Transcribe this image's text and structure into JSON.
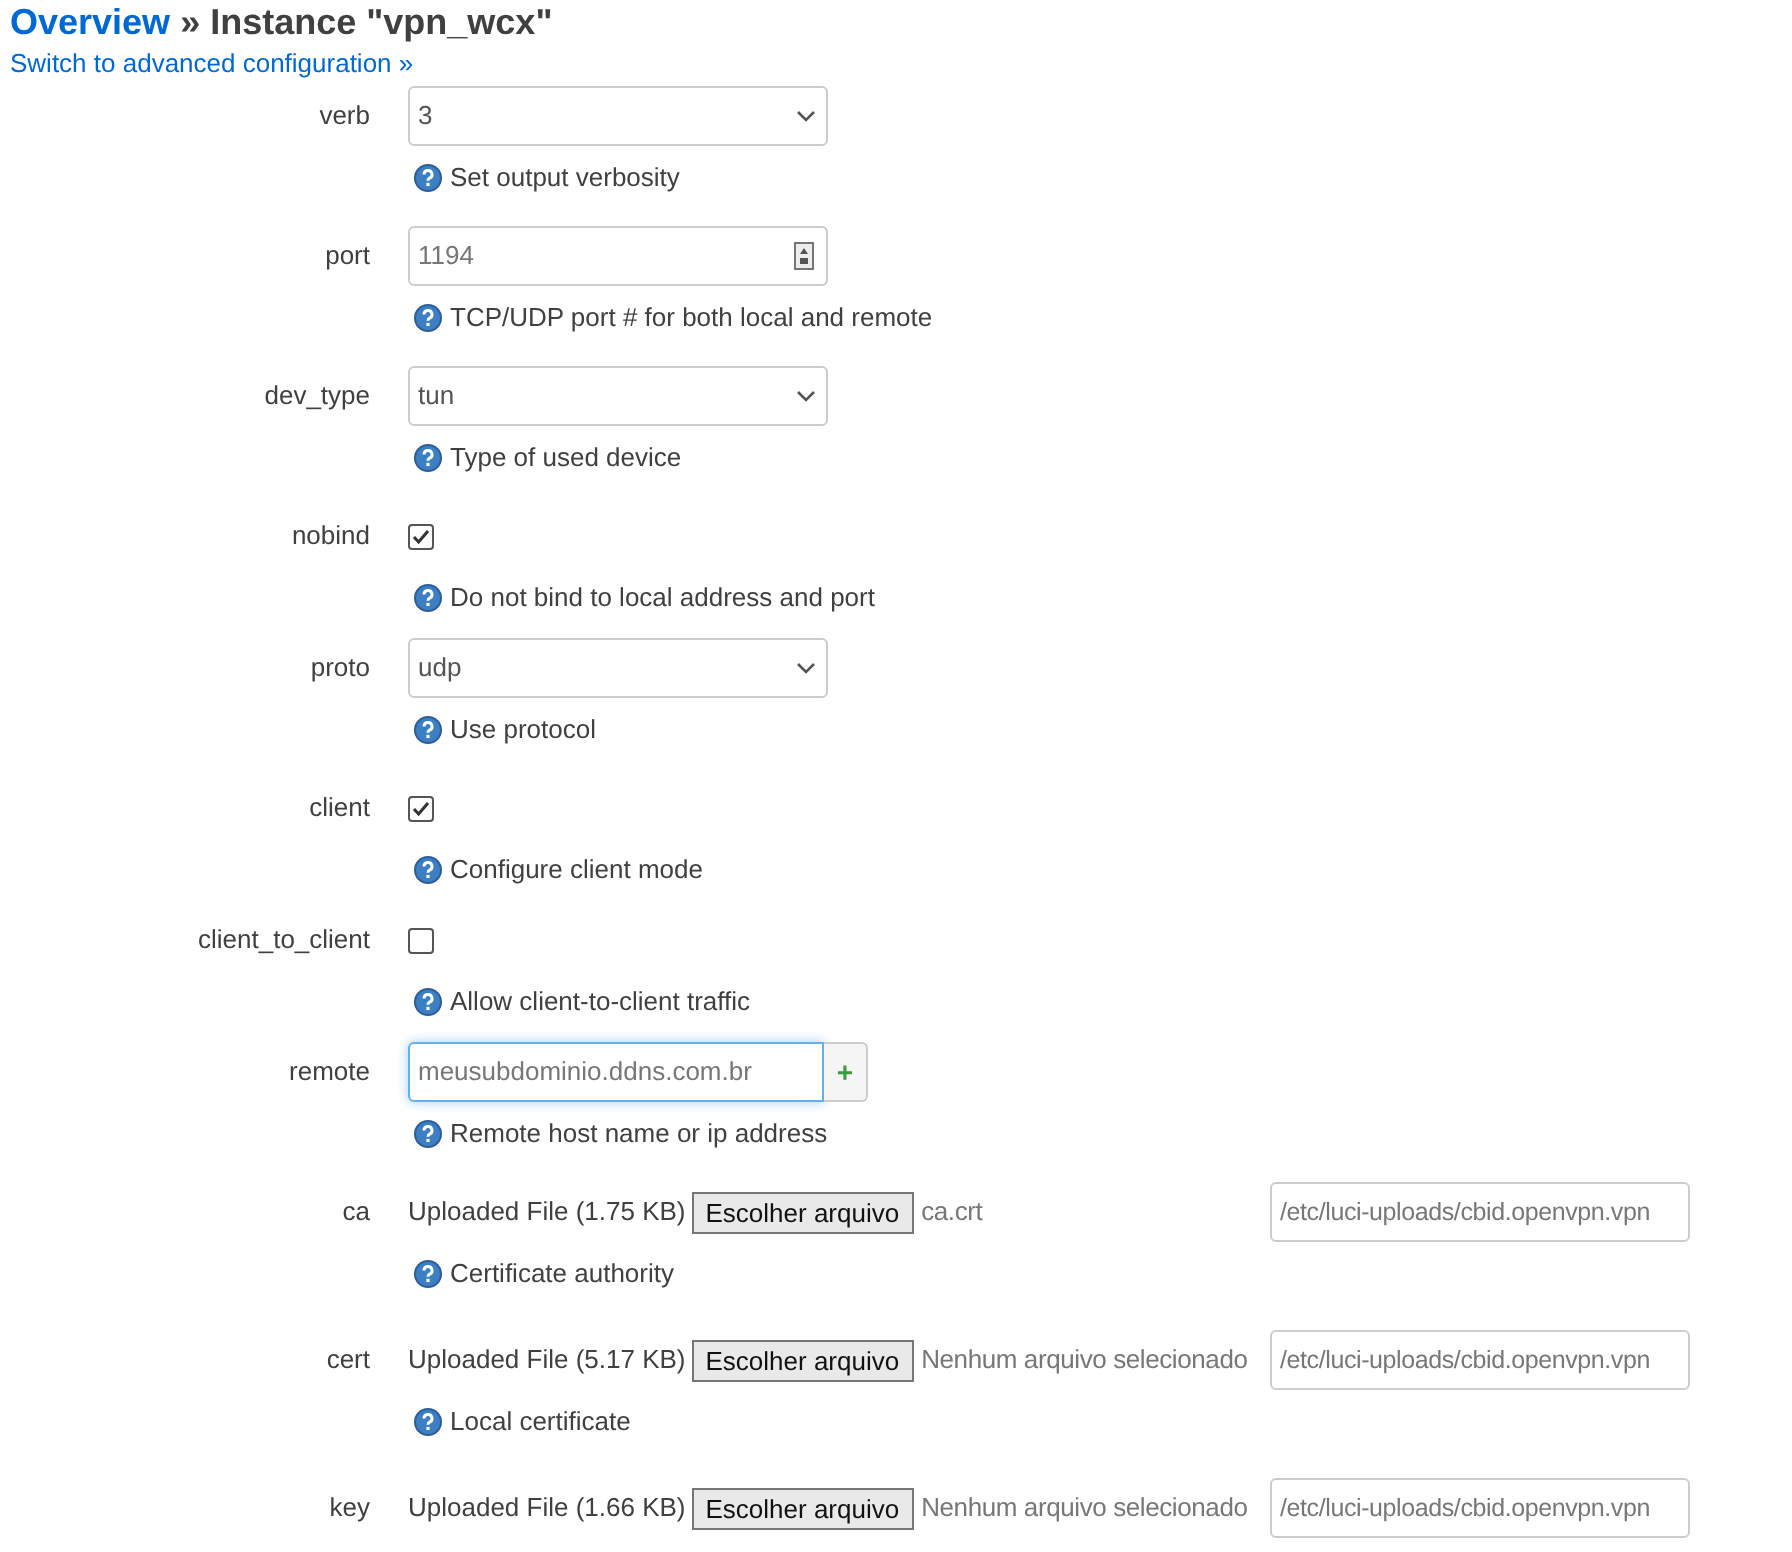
{
  "breadcrumb": {
    "link": "Overview",
    "separator": "»",
    "title": "Instance \"vpn_wcx\""
  },
  "switch_link": "Switch to advanced configuration »",
  "options": [
    {
      "kind": "select",
      "label": "verb",
      "value": "3",
      "help": "Set output verbosity"
    },
    {
      "kind": "number",
      "label": "port",
      "placeholder": "1194",
      "help": "TCP/UDP port # for both local and remote"
    },
    {
      "kind": "select",
      "label": "dev_type",
      "value": "tun",
      "help": "Type of used device"
    },
    {
      "kind": "checkbox",
      "label": "nobind",
      "checked": true,
      "help": "Do not bind to local address and port"
    },
    {
      "kind": "select",
      "label": "proto",
      "value": "udp",
      "help": "Use protocol"
    },
    {
      "kind": "checkbox",
      "label": "client",
      "checked": true,
      "help": "Configure client mode"
    },
    {
      "kind": "checkbox",
      "label": "client_to_client",
      "checked": false,
      "help": "Allow client-to-client traffic"
    },
    {
      "kind": "list",
      "label": "remote",
      "value": "meusubdominio.ddns.com.br",
      "add": "+",
      "focused": true,
      "help": "Remote host name or ip address"
    },
    {
      "kind": "file",
      "label": "ca",
      "uploaded": "Uploaded File (1.75 KB)",
      "button": "Escolher arquivo",
      "file_name": "ca.crt",
      "path": "/etc/luci-uploads/cbid.openvpn.vpn",
      "help": "Certificate authority"
    },
    {
      "kind": "file",
      "label": "cert",
      "uploaded": "Uploaded File (5.17 KB)",
      "button": "Escolher arquivo",
      "file_name": "Nenhum arquivo selecionado",
      "path": "/etc/luci-uploads/cbid.openvpn.vpn",
      "help": "Local certificate"
    },
    {
      "kind": "file",
      "label": "key",
      "uploaded": "Uploaded File (1.66 KB)",
      "button": "Escolher arquivo",
      "file_name": "Nenhum arquivo selecionado",
      "path": "/etc/luci-uploads/cbid.openvpn.vpn"
    }
  ]
}
